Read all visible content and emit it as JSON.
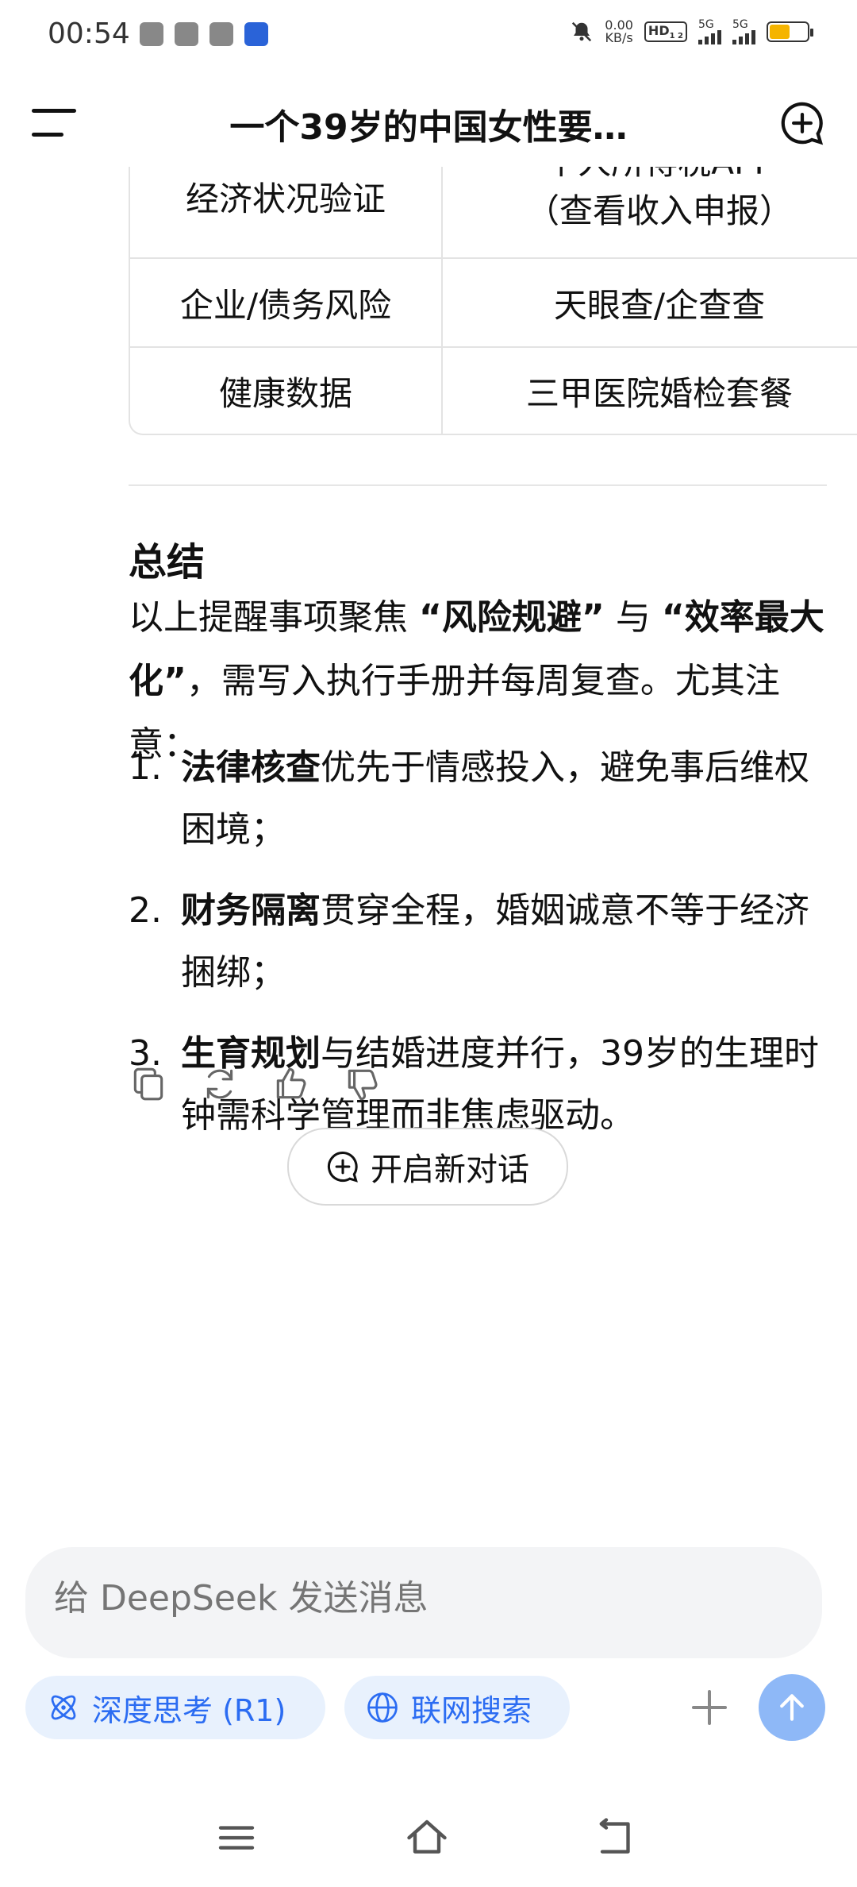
{
  "status_bar": {
    "time": "00:54",
    "net_speed_value": "0.00",
    "net_speed_unit": "KB/s",
    "hd_label": "HD",
    "hd_sub": "1 2",
    "sim1_label": "5G",
    "sim2_label": "5G",
    "battery_level": 0.55
  },
  "header": {
    "title": "一个39岁的中国女性要…"
  },
  "table": {
    "rows": [
      {
        "left": "经济状况验证",
        "right_cut": "个人所得税APP",
        "right": "（查看收入申报）"
      },
      {
        "left": "企业/债务风险",
        "right": "天眼查/企查查"
      },
      {
        "left": "健康数据",
        "right": "三甲医院婚检套餐"
      }
    ]
  },
  "summary": {
    "title": "总结",
    "p_a": "以上提醒事项聚焦 ",
    "p_b": "“风险规避”",
    "p_c": " 与 ",
    "p_d": "“效率最大化”",
    "p_e": "，需写入执行手册并每周复查。尤其注意：",
    "items": [
      {
        "num": "1.",
        "bold": "法律核查",
        "text": "优先于情感投入，避免事后维权困境；"
      },
      {
        "num": "2.",
        "bold": "财务隔离",
        "text": "贯穿全程，婚姻诚意不等于经济捆绑；"
      },
      {
        "num": "3.",
        "bold": "生育规划",
        "text": "与结婚进度并行，39岁的生理时钟需科学管理而非焦虑驱动。"
      }
    ]
  },
  "new_chat_button": "开启新对话",
  "input": {
    "placeholder": "给 DeepSeek 发送消息"
  },
  "chips": {
    "deep_think": "深度思考 (R1)",
    "web_search": "联网搜索"
  },
  "colors": {
    "accent": "#2b6cf2",
    "chip_bg": "#e8f1fd",
    "send_bg": "#8eb8f7",
    "battery": "#f5b400"
  }
}
